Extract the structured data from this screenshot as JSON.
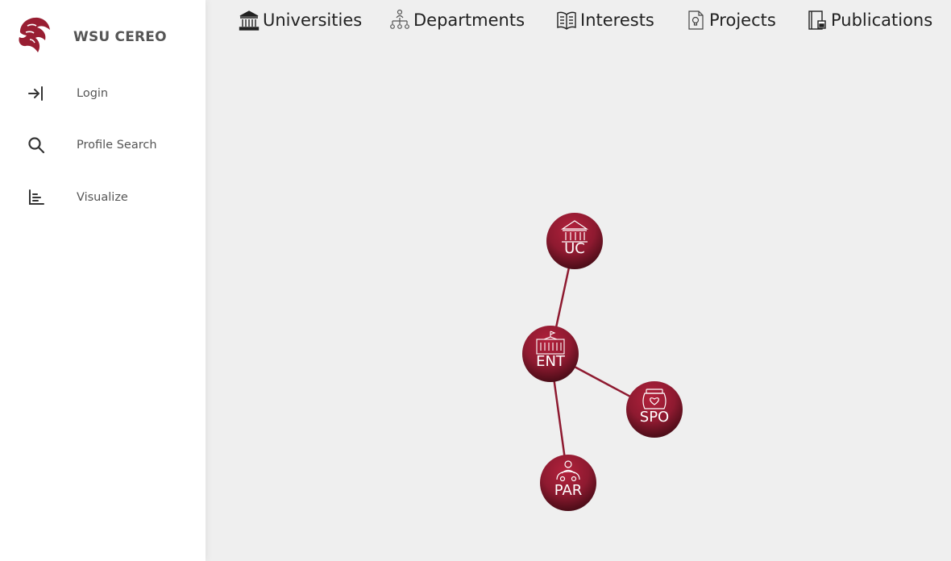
{
  "app": {
    "brand_title": "WSU CEREO",
    "logo_icon": "cougar-logo-icon",
    "accent_color": "#981e32",
    "node_dark_color": "#4d0d16"
  },
  "sidebar": {
    "items": [
      {
        "label": "Login",
        "icon": "login-icon"
      },
      {
        "label": "Profile Search",
        "icon": "search-icon"
      },
      {
        "label": "Visualize",
        "icon": "bar-chart-icon"
      }
    ]
  },
  "tabs": [
    {
      "label": "Universities",
      "icon": "university-icon"
    },
    {
      "label": "Departments",
      "icon": "department-tree-icon"
    },
    {
      "label": "Interests",
      "icon": "open-book-icon"
    },
    {
      "label": "Projects",
      "icon": "project-document-icon"
    },
    {
      "label": "Publications",
      "icon": "publication-icon"
    }
  ],
  "graph": {
    "nodes": [
      {
        "id": "UC",
        "label": "UC",
        "icon": "university-icon"
      },
      {
        "id": "ENT",
        "label": "ENT",
        "icon": "building-icon"
      },
      {
        "id": "SPO",
        "label": "SPO",
        "icon": "heart-jar-icon"
      },
      {
        "id": "PAR",
        "label": "PAR",
        "icon": "person-group-icon"
      }
    ],
    "edges": [
      {
        "from": "ENT",
        "to": "UC"
      },
      {
        "from": "ENT",
        "to": "SPO"
      },
      {
        "from": "ENT",
        "to": "PAR"
      }
    ]
  }
}
